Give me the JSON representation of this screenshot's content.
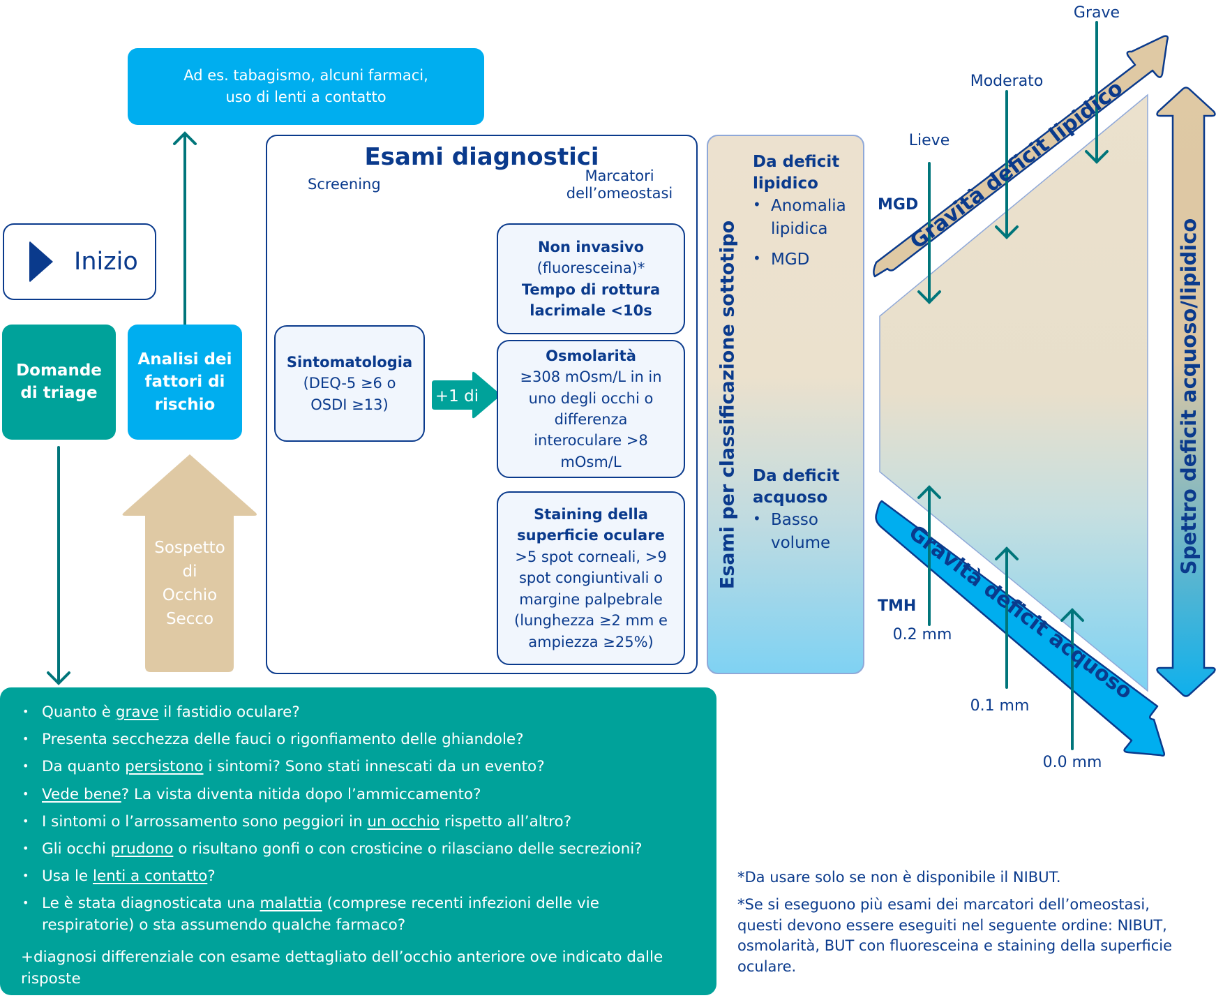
{
  "start": {
    "label": "Inizio",
    "icon": "play-triangle-icon"
  },
  "triage": {
    "title_line1": "Domande",
    "title_line2": "di triage"
  },
  "risk": {
    "title_line1": "Analisi dei",
    "title_line2": "fattori di",
    "title_line3": "rischio",
    "examples_line1": "Ad es. tabagismo, alcuni farmaci,",
    "examples_line2": "uso di lenti a contatto"
  },
  "suspicion": {
    "lines": [
      "Sospetto",
      "di",
      "Occhio",
      "Secco"
    ]
  },
  "diagnostics": {
    "title": "Esami diagnostici",
    "screening_label": "Screening",
    "markers_label_line1": "Marcatori",
    "markers_label_line2": "dell’omeostasi",
    "symptoms": {
      "title": "Sintomatologia",
      "line1": "(DEQ-5 ≥6 o",
      "line2": "OSDI ≥13)"
    },
    "connector_label": "+1 di",
    "nibut": {
      "title": "Non invasivo",
      "sub": "(fluoresceina)*",
      "line1": "Tempo di rottura",
      "line2": "lacrimale <10s"
    },
    "osmolarity": {
      "title": "Osmolarità",
      "lines": [
        "≥308 mOsm/L in in",
        "uno degli occhi o",
        "differenza",
        "interoculare >8",
        "mOsm/L"
      ]
    },
    "staining": {
      "title_line1": "Staining della",
      "title_line2": "superficie oculare",
      "lines": [
        ">5 spot corneali, >9",
        "spot congiuntivali o",
        "margine palpebrale",
        "(lunghezza ≥2 mm e",
        "ampiezza ≥25%)"
      ]
    }
  },
  "subtype": {
    "vertical_title": "Esami per classificazione sottotipo",
    "lipid": {
      "head_line1": "Da deficit",
      "head_line2": "lipidico",
      "items": [
        "Anomalia lipidica",
        "MGD"
      ]
    },
    "aqueous": {
      "head_line1": "Da deficit",
      "head_line2": "acquoso",
      "items": [
        "Basso volume"
      ]
    }
  },
  "severity": {
    "lipid_arrow_label": "Gravità deficit lipidico",
    "aqueous_arrow_label": "Gravità deficit acquoso",
    "spectrum_label": "Spettro deficit acquoso/lipidico",
    "mgd_label": "MGD",
    "tmh_label": "TMH",
    "lipid_levels": [
      "Lieve",
      "Moderato",
      "Grave"
    ],
    "tmh_levels": [
      "0.2 mm",
      "0.1 mm",
      "0.0 mm"
    ]
  },
  "questions": {
    "items": [
      {
        "pre": "Quanto è ",
        "u": "grave",
        "post": " il fastidio oculare?"
      },
      {
        "pre": "Presenta secchezza delle fauci o rigonfiamento delle ghiandole?",
        "u": "",
        "post": ""
      },
      {
        "pre": "Da quanto ",
        "u": "persistono",
        "post": " i sintomi? Sono stati innescati da un evento?"
      },
      {
        "pre": "",
        "u": "Vede bene",
        "post": "? La vista diventa nitida dopo l’ammiccamento?"
      },
      {
        "pre": "I sintomi o l’arrossamento sono peggiori in ",
        "u": "un occhio",
        "post": " rispetto all’altro?"
      },
      {
        "pre": "Gli occhi ",
        "u": "prudono",
        "post": " o risultano gonfi o con crosticine o rilasciano delle secrezioni?"
      },
      {
        "pre": "Usa le ",
        "u": "lenti a contatto",
        "post": "?"
      },
      {
        "pre": "Le è stata diagnosticata una ",
        "u": "malattia",
        "post": " (comprese recenti infezioni delle vie respiratorie) o sta assumendo qualche farmaco?"
      }
    ],
    "footer": "+diagnosi differenziale con esame dettagliato dell’occhio anteriore ove indicato dalle risposte"
  },
  "footnotes": {
    "note1": "*Da usare solo se non è disponibile il NIBUT.",
    "note2": "*Se si eseguono più esami dei marcatori dell’omeostasi, questi devono essere eseguiti nel seguente ordine: NIBUT, osmolarità, BUT con fluoresceina e staining della superficie oculare."
  },
  "colors": {
    "navy": "#0a3a8c",
    "teal": "#00a29a",
    "sky": "#00aeef",
    "tan": "#dfc9a4",
    "arrow_teal": "#00757a"
  }
}
